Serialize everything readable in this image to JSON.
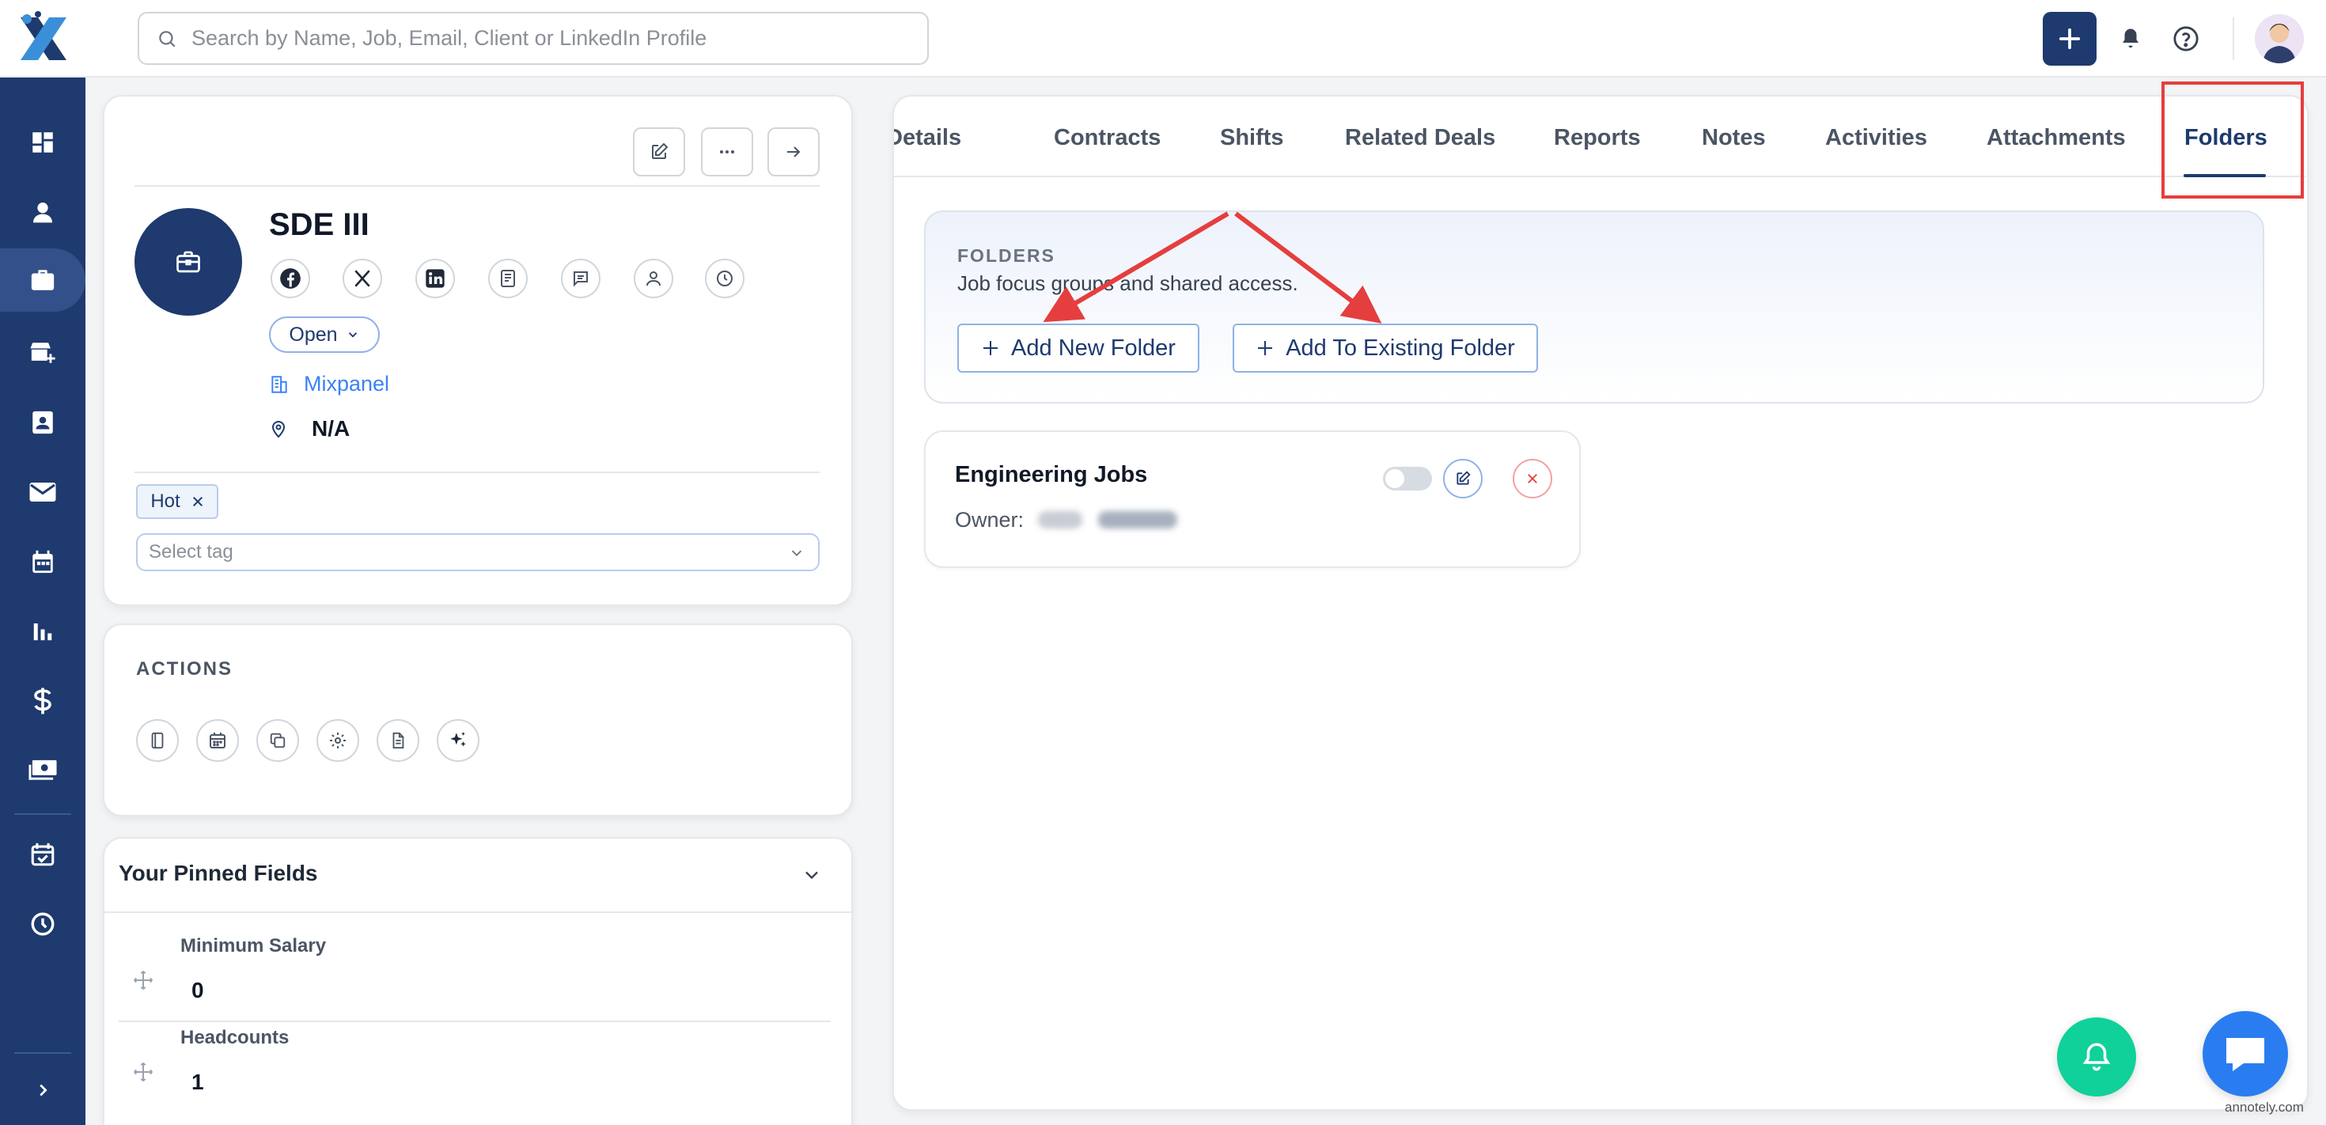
{
  "search": {
    "placeholder": "Search by Name, Job, Email, Client or LinkedIn Profile"
  },
  "job": {
    "title": "SDE III",
    "status": "Open",
    "company": "Mixpanel",
    "location": "N/A",
    "tags": [
      "Hot"
    ],
    "tag_placeholder": "Select tag"
  },
  "actions": {
    "heading": "ACTIONS"
  },
  "pinned": {
    "title": "Your Pinned Fields",
    "fields": [
      {
        "label": "Minimum Salary",
        "value": "0"
      },
      {
        "label": "Headcounts",
        "value": "1"
      }
    ]
  },
  "tabs": [
    "Details",
    "Contracts",
    "Shifts",
    "Related Deals",
    "Reports",
    "Notes",
    "Activities",
    "Attachments",
    "Folders"
  ],
  "active_tab": "Folders",
  "folders": {
    "label": "FOLDERS",
    "description": "Job focus groups and shared access.",
    "add_new": "Add New Folder",
    "add_existing": "Add To Existing Folder",
    "items": [
      {
        "name": "Engineering Jobs",
        "owner_label": "Owner:"
      }
    ]
  },
  "watermark": "annotely.com",
  "colors": {
    "brand": "#1e3a6e",
    "accent": "#3b82f6",
    "highlight": "#e53e3e",
    "bell_fab": "#10d19a",
    "chat_fab": "#2a7df0"
  }
}
